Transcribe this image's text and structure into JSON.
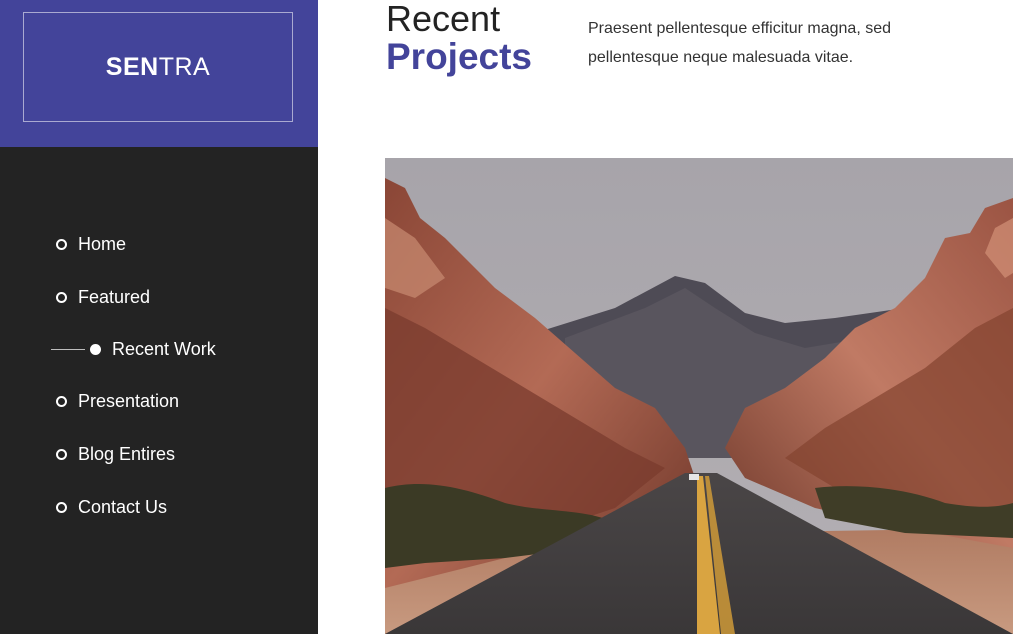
{
  "brand": {
    "name_bold": "SEN",
    "name_light": "TRA"
  },
  "nav": {
    "items": [
      {
        "label": "Home",
        "active": false
      },
      {
        "label": "Featured",
        "active": false
      },
      {
        "label": "Recent Work",
        "active": true
      },
      {
        "label": "Presentation",
        "active": false
      },
      {
        "label": "Blog Entires",
        "active": false
      },
      {
        "label": "Contact Us",
        "active": false
      }
    ]
  },
  "section": {
    "title_light": "Recent",
    "title_bold": "Projects",
    "intro": "Praesent pellentesque efficitur magna, sed pellentesque neque malesuada vitae."
  },
  "colors": {
    "accent": "#43449a",
    "sidebar": "#232323",
    "text": "#333333"
  }
}
